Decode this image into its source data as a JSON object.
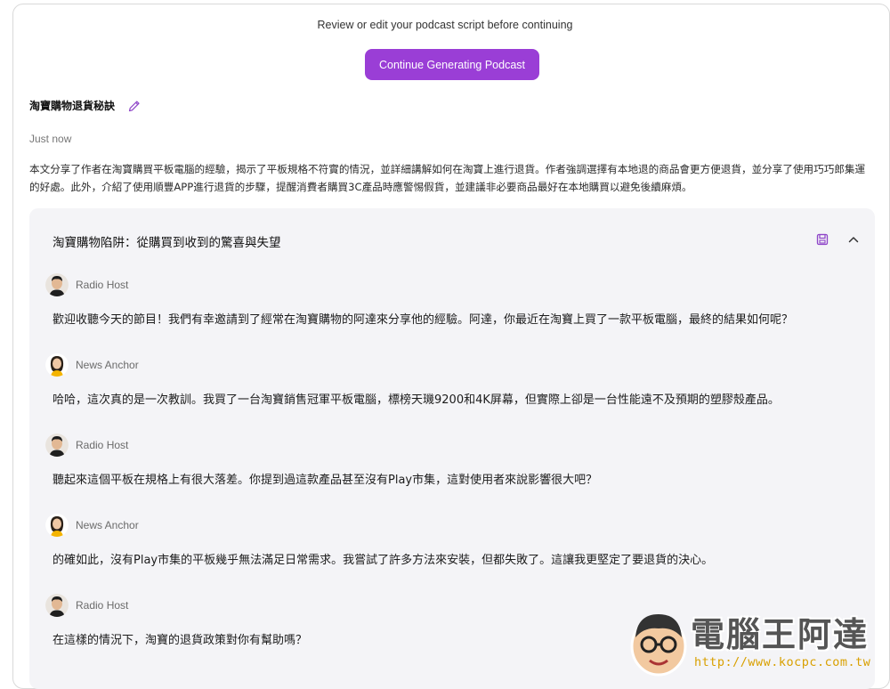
{
  "header": {
    "note": "Review or edit your podcast script before continuing",
    "continue_label": "Continue Generating Podcast"
  },
  "script": {
    "title": "淘寶購物退貨秘訣",
    "timestamp": "Just now",
    "summary": "本文分享了作者在淘寶購買平板電腦的經驗，揭示了平板規格不符實的情況，並詳細講解如何在淘寶上進行退貨。作者強調選擇有本地退的商品會更方便退貨，並分享了使用巧巧郎集運的好處。此外，介紹了使用順豐APP進行退貨的步驟，提醒消費者購買3C產品時應警惕假貨，並建議非必要商品最好在本地購買以避免後續麻煩。"
  },
  "section": {
    "title": "淘寶購物陷阱：從購買到收到的驚喜與失望",
    "save_icon": "save-icon",
    "collapse_icon": "chevron-up-icon",
    "turns": [
      {
        "speaker": "Radio Host",
        "text": "歡迎收聽今天的節目！我們有幸邀請到了經常在淘寶購物的阿達來分享他的經驗。阿達，你最近在淘寶上買了一款平板電腦，最終的結果如何呢？"
      },
      {
        "speaker": "News Anchor",
        "text": "哈哈，這次真的是一次教訓。我買了一台淘寶銷售冠軍平板電腦，標榜天璣9200和4K屏幕，但實際上卻是一台性能遠不及預期的塑膠殼產品。"
      },
      {
        "speaker": "Radio Host",
        "text": "聽起來這個平板在規格上有很大落差。你提到過這款產品甚至沒有Play市集，這對使用者來說影響很大吧？"
      },
      {
        "speaker": "News Anchor",
        "text": "的確如此，沒有Play市集的平板幾乎無法滿足日常需求。我嘗試了許多方法來安裝，但都失敗了。這讓我更堅定了要退貨的決心。"
      },
      {
        "speaker": "Radio Host",
        "text": "在這樣的情況下，淘寶的退貨政策對你有幫助嗎？"
      }
    ]
  },
  "watermark": {
    "name": "電腦王阿達",
    "url": "http://www.kocpc.com.tw"
  },
  "colors": {
    "accent": "#9a3ed6",
    "panel": "#f4f4f7"
  }
}
